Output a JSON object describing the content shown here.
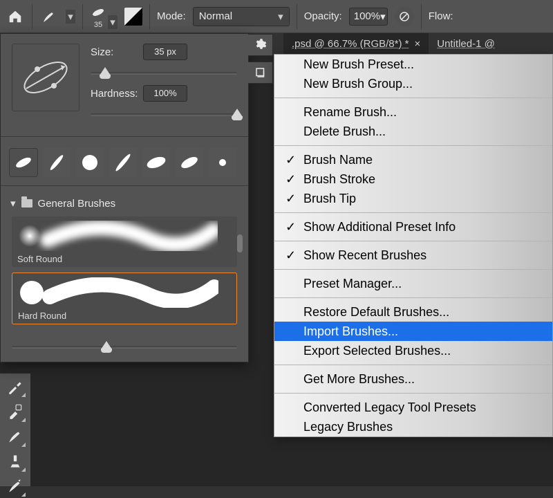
{
  "toolbar": {
    "brush_size_indicator": "35",
    "mode_label": "Mode:",
    "mode_value": "Normal",
    "opacity_label": "Opacity:",
    "opacity_value": "100%",
    "flow_label": "Flow:"
  },
  "tabs": [
    {
      "name": ".psd @ 66.7% (RGB/8*) *",
      "active": true
    },
    {
      "name": "Untitled-1 @",
      "active": false
    }
  ],
  "brushPanel": {
    "size_label": "Size:",
    "size_value": "35 px",
    "size_slider_pct": 10,
    "hardness_label": "Hardness:",
    "hardness_value": "100%",
    "hardness_slider_pct": 100,
    "group_name": "General Brushes",
    "presets": [
      {
        "label": "Soft Round"
      },
      {
        "label": "Hard Round"
      }
    ]
  },
  "contextMenu": {
    "items": [
      {
        "label": "New Brush Preset...",
        "type": "item"
      },
      {
        "label": "New Brush Group...",
        "type": "item"
      },
      {
        "type": "sep"
      },
      {
        "label": "Rename Brush...",
        "type": "item"
      },
      {
        "label": "Delete Brush...",
        "type": "item"
      },
      {
        "type": "sep"
      },
      {
        "label": "Brush Name",
        "type": "item",
        "checked": true
      },
      {
        "label": "Brush Stroke",
        "type": "item",
        "checked": true
      },
      {
        "label": "Brush Tip",
        "type": "item",
        "checked": true
      },
      {
        "type": "sep"
      },
      {
        "label": "Show Additional Preset Info",
        "type": "item",
        "checked": true
      },
      {
        "type": "sep"
      },
      {
        "label": "Show Recent Brushes",
        "type": "item",
        "checked": true
      },
      {
        "type": "sep"
      },
      {
        "label": "Preset Manager...",
        "type": "item"
      },
      {
        "type": "sep"
      },
      {
        "label": "Restore Default Brushes...",
        "type": "item"
      },
      {
        "label": "Import Brushes...",
        "type": "item",
        "highlight": true
      },
      {
        "label": "Export Selected Brushes...",
        "type": "item"
      },
      {
        "type": "sep"
      },
      {
        "label": "Get More Brushes...",
        "type": "item"
      },
      {
        "type": "sep"
      },
      {
        "label": "Converted Legacy Tool Presets",
        "type": "item"
      },
      {
        "label": "Legacy Brushes",
        "type": "item"
      }
    ]
  }
}
